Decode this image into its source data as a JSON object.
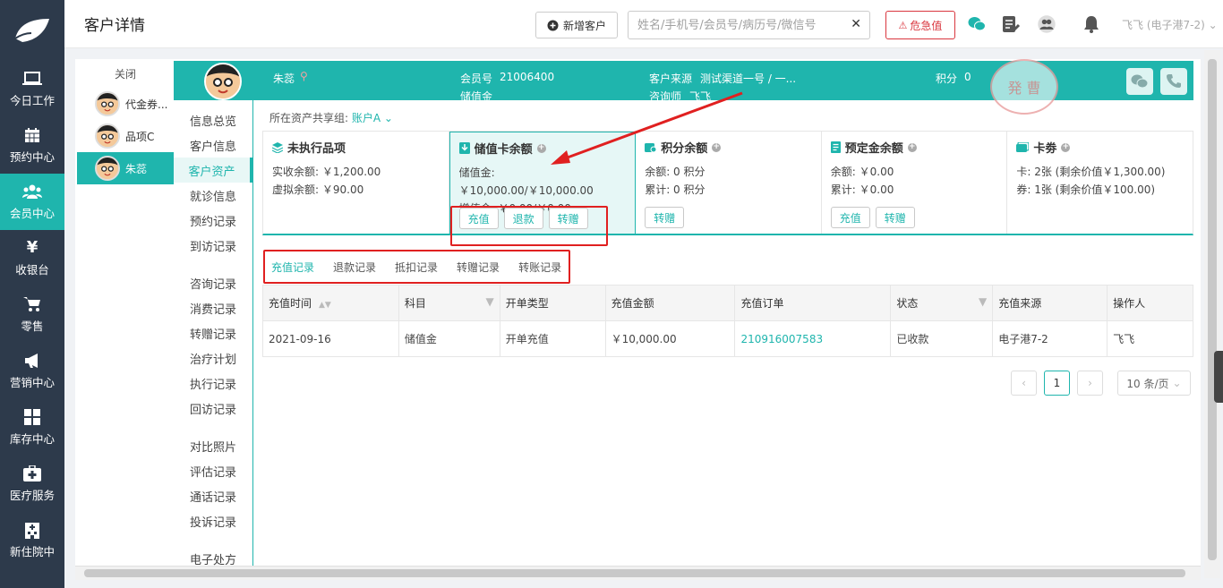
{
  "nav": {
    "items": [
      {
        "label": "今日工作",
        "icon": "laptop-icon"
      },
      {
        "label": "预约中心",
        "icon": "calendar-icon"
      },
      {
        "label": "会员中心",
        "icon": "members-icon",
        "active": true
      },
      {
        "label": "收银台",
        "icon": "yen-icon"
      },
      {
        "label": "零售",
        "icon": "cart-icon"
      },
      {
        "label": "营销中心",
        "icon": "megaphone-icon"
      },
      {
        "label": "库存中心",
        "icon": "grid-icon"
      },
      {
        "label": "医疗服务",
        "icon": "medkit-icon"
      },
      {
        "label": "新住院中",
        "icon": "hospital-icon"
      }
    ]
  },
  "header": {
    "title": "客户详情",
    "new_customer": "新增客户",
    "search_placeholder": "姓名/手机号/会员号/病历号/微信号",
    "danger_label": "危急值",
    "user": "飞飞 (电子港7-2)"
  },
  "side_list": {
    "close_label": "关闭",
    "customers": [
      {
        "name": "代金券..."
      },
      {
        "name": "品项C"
      },
      {
        "name": "朱蕊",
        "active": true
      }
    ]
  },
  "banner": {
    "name": "朱蕊",
    "member_no_label": "会员号",
    "member_no": "21006400",
    "member_type": "储值金",
    "source_label": "客户来源",
    "source": "测试渠道一号 / 一...",
    "consultant_label": "咨询师",
    "consultant": "飞飞",
    "points_label": "积分",
    "points": "0",
    "stamp": "発 曹"
  },
  "subnav": {
    "group1": [
      "信息总览",
      "客户信息",
      "客户资产",
      "就诊信息",
      "预约记录",
      "到访记录"
    ],
    "group2": [
      "咨询记录",
      "消费记录",
      "转赠记录",
      "治疗计划",
      "执行记录",
      "回访记录"
    ],
    "group3": [
      "对比照片",
      "评估记录",
      "通话记录",
      "投诉记录"
    ],
    "group4": [
      "电子处方"
    ],
    "active": "客户资产"
  },
  "share": {
    "label": "所在资产共享组:",
    "account": "账户A"
  },
  "cards": [
    {
      "title": "未执行品项",
      "lines": [
        "实收余额: ￥1,200.00",
        "虚拟余额: ￥90.00"
      ],
      "buttons": []
    },
    {
      "title": "储值卡余额",
      "lines": [
        "储值金: ￥10,000.00/￥10,000.00",
        "增值金: ￥0.00/￥0.00"
      ],
      "buttons": [
        "充值",
        "退款",
        "转赠"
      ]
    },
    {
      "title": "积分余额",
      "lines": [
        "余额: 0 积分",
        "累计: 0 积分"
      ],
      "buttons": [
        "转赠"
      ]
    },
    {
      "title": "预定金余额",
      "lines": [
        "余额: ￥0.00",
        "累计: ￥0.00"
      ],
      "buttons": [
        "充值",
        "转赠"
      ]
    },
    {
      "title": "卡劵",
      "lines": [
        "卡: 2张 (剩余价值￥1,300.00)",
        "券: 1张 (剩余价值￥100.00)"
      ],
      "buttons": []
    }
  ],
  "tabs": [
    "充值记录",
    "退款记录",
    "抵扣记录",
    "转赠记录",
    "转账记录"
  ],
  "table": {
    "headers": [
      "充值时间",
      "科目",
      "开单类型",
      "充值金额",
      "充值订单",
      "状态",
      "充值来源",
      "操作人"
    ],
    "rows": [
      [
        "2021-09-16",
        "储值金",
        "开单充值",
        "￥10,000.00",
        "210916007583",
        "已收款",
        "电子港7-2",
        "飞飞"
      ]
    ]
  },
  "pager": {
    "current": "1",
    "page_size": "10 条/页"
  },
  "colors": {
    "primary": "#1fb5ad",
    "nav_bg": "#2d3a4b",
    "danger": "#d9363e"
  }
}
